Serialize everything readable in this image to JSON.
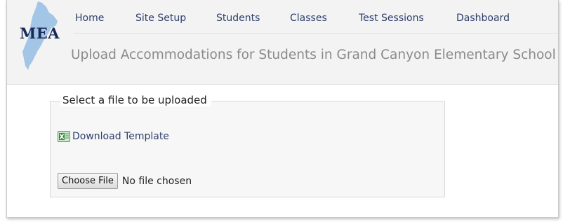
{
  "logo": {
    "text": "MEA",
    "shape_color": "#9ec3e6",
    "text_color": "#1a2a56"
  },
  "nav": {
    "items": [
      {
        "label": "Home"
      },
      {
        "label": "Site Setup"
      },
      {
        "label": "Students"
      },
      {
        "label": "Classes"
      },
      {
        "label": "Test Sessions"
      },
      {
        "label": "Dashboard"
      }
    ],
    "link_color": "#2c3e6b"
  },
  "page": {
    "title": "Upload Accommodations for Students in Grand Canyon Elementary School"
  },
  "upload": {
    "legend": "Select a file to be uploaded",
    "download_label": "Download Template",
    "download_icon": "excel-icon",
    "choose_button_label": "Choose File",
    "file_status": "No file chosen"
  }
}
